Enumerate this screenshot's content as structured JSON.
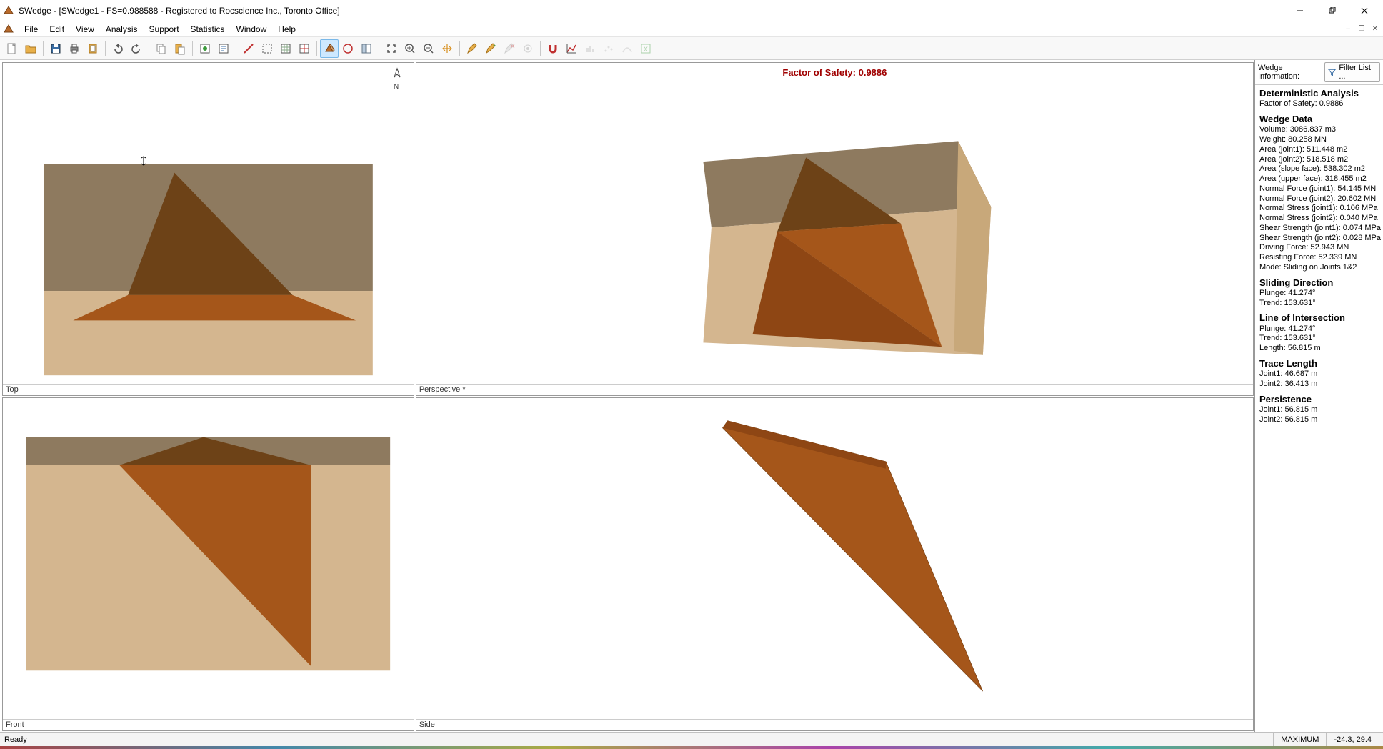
{
  "window": {
    "title": "SWedge - [SWedge1 - FS=0.988588 - Registered to Rocscience Inc., Toronto Office]"
  },
  "menu": {
    "file": "File",
    "edit": "Edit",
    "view": "View",
    "analysis": "Analysis",
    "support": "Support",
    "statistics": "Statistics",
    "window": "Window",
    "help": "Help"
  },
  "viewports": {
    "top": "Top",
    "perspective": "Perspective *",
    "front": "Front",
    "side": "Side",
    "fos_label": "Factor of Safety: 0.9886"
  },
  "sidepanel": {
    "head_label": "Wedge Information:",
    "filter_label": "Filter List ...",
    "deterministic_h": "Deterministic Analysis",
    "fos": "Factor of Safety: 0.9886",
    "wedge_h": "Wedge Data",
    "wedge": {
      "volume": "Volume: 3086.837 m3",
      "weight": "Weight: 80.258 MN",
      "area_j1": "Area (joint1): 511.448 m2",
      "area_j2": "Area (joint2): 518.518 m2",
      "area_slope": "Area (slope face): 538.302 m2",
      "area_upper": "Area (upper face): 318.455 m2",
      "nforce_j1": "Normal Force (joint1): 54.145 MN",
      "nforce_j2": "Normal Force (joint2): 20.602 MN",
      "nstress_j1": "Normal Stress (joint1): 0.106 MPa",
      "nstress_j2": "Normal Stress (joint2): 0.040 MPa",
      "sstr_j1": "Shear Strength (joint1): 0.074 MPa",
      "sstr_j2": "Shear Strength (joint2): 0.028 MPa",
      "driving": "Driving Force: 52.943 MN",
      "resisting": "Resisting Force: 52.339 MN",
      "mode": "Mode: Sliding on Joints 1&2"
    },
    "sliding_h": "Sliding Direction",
    "sliding": {
      "plunge": "Plunge: 41.274°",
      "trend": "Trend: 153.631°"
    },
    "loi_h": "Line of Intersection",
    "loi": {
      "plunge": "Plunge: 41.274°",
      "trend": "Trend: 153.631°",
      "length": "Length: 56.815 m"
    },
    "trace_h": "Trace Length",
    "trace": {
      "j1": "Joint1: 46.687 m",
      "j2": "Joint2: 36.413 m"
    },
    "persist_h": "Persistence",
    "persist": {
      "j1": "Joint1: 56.815 m",
      "j2": "Joint2: 56.815 m"
    }
  },
  "status": {
    "ready": "Ready",
    "mode": "MAXIMUM",
    "coords": "-24.3, 29.4"
  }
}
